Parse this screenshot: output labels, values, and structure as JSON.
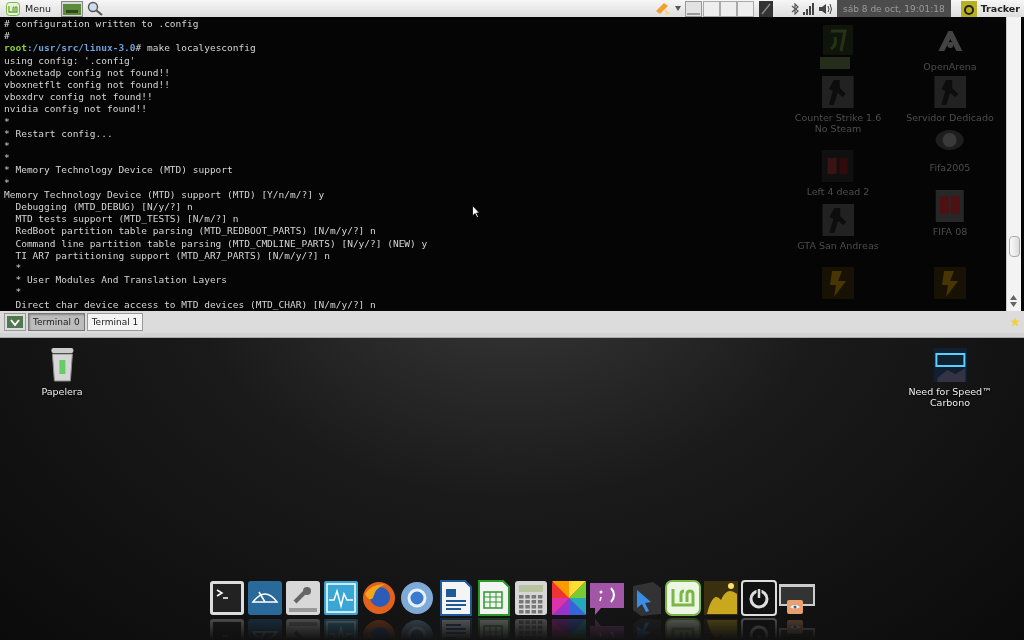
{
  "panel": {
    "menu_label": "Menu",
    "clock": "sáb 8 de oct, 19:01:18",
    "tracker_label": "Tracker"
  },
  "terminal": {
    "lines": [
      {
        "kind": "output",
        "text": "# configuration written to .config"
      },
      {
        "kind": "output",
        "text": "#"
      },
      {
        "kind": "prompt",
        "user": "root",
        "path": ":/usr/src/linux-3.0",
        "text": "# make localyesconfig"
      },
      {
        "kind": "output",
        "text": "using config: '.config'"
      },
      {
        "kind": "output",
        "text": "vboxnetadp config not found!!"
      },
      {
        "kind": "output",
        "text": "vboxnetflt config not found!!"
      },
      {
        "kind": "output",
        "text": "vboxdrv config not found!!"
      },
      {
        "kind": "output",
        "text": "nvidia config not found!!"
      },
      {
        "kind": "output",
        "text": "*"
      },
      {
        "kind": "output",
        "text": "* Restart config..."
      },
      {
        "kind": "output",
        "text": "*"
      },
      {
        "kind": "output",
        "text": "*"
      },
      {
        "kind": "output",
        "text": "* Memory Technology Device (MTD) support"
      },
      {
        "kind": "output",
        "text": "*"
      },
      {
        "kind": "output",
        "text": "Memory Technology Device (MTD) support (MTD) [Y/n/m/?] y"
      },
      {
        "kind": "output",
        "text": "  Debugging (MTD_DEBUG) [N/y/?] n"
      },
      {
        "kind": "output",
        "text": "  MTD tests support (MTD_TESTS) [N/m/?] n"
      },
      {
        "kind": "output",
        "text": "  RedBoot partition table parsing (MTD_REDBOOT_PARTS) [N/m/y/?] n"
      },
      {
        "kind": "output",
        "text": "  Command line partition table parsing (MTD_CMDLINE_PARTS) [N/y/?] (NEW) y"
      },
      {
        "kind": "output",
        "text": "  TI AR7 partitioning support (MTD_AR7_PARTS) [N/m/y/?] n"
      },
      {
        "kind": "output",
        "text": "  *"
      },
      {
        "kind": "output",
        "text": "  * User Modules And Translation Layers"
      },
      {
        "kind": "output",
        "text": "  *"
      },
      {
        "kind": "output",
        "text": "  Direct char device access to MTD devices (MTD_CHAR) [N/m/y/?] n"
      }
    ],
    "background_icons": [
      {
        "label": "OpenArena"
      },
      {
        "label": "Counter Strike 1.6\nNo Steam"
      },
      {
        "label": "Servidor Dedicado"
      },
      {
        "label": "Fifa2005"
      },
      {
        "label": "Left 4 dead 2"
      },
      {
        "label": "FIFA 08"
      },
      {
        "label": "GTA San Andreas"
      }
    ]
  },
  "tabs": [
    {
      "label": "Terminal 0",
      "selected": true
    },
    {
      "label": "Terminal 1",
      "selected": false
    }
  ],
  "desktop_icons": [
    {
      "label": "Papelera"
    },
    {
      "label": "Need for Speed™\nCarbono"
    }
  ]
}
